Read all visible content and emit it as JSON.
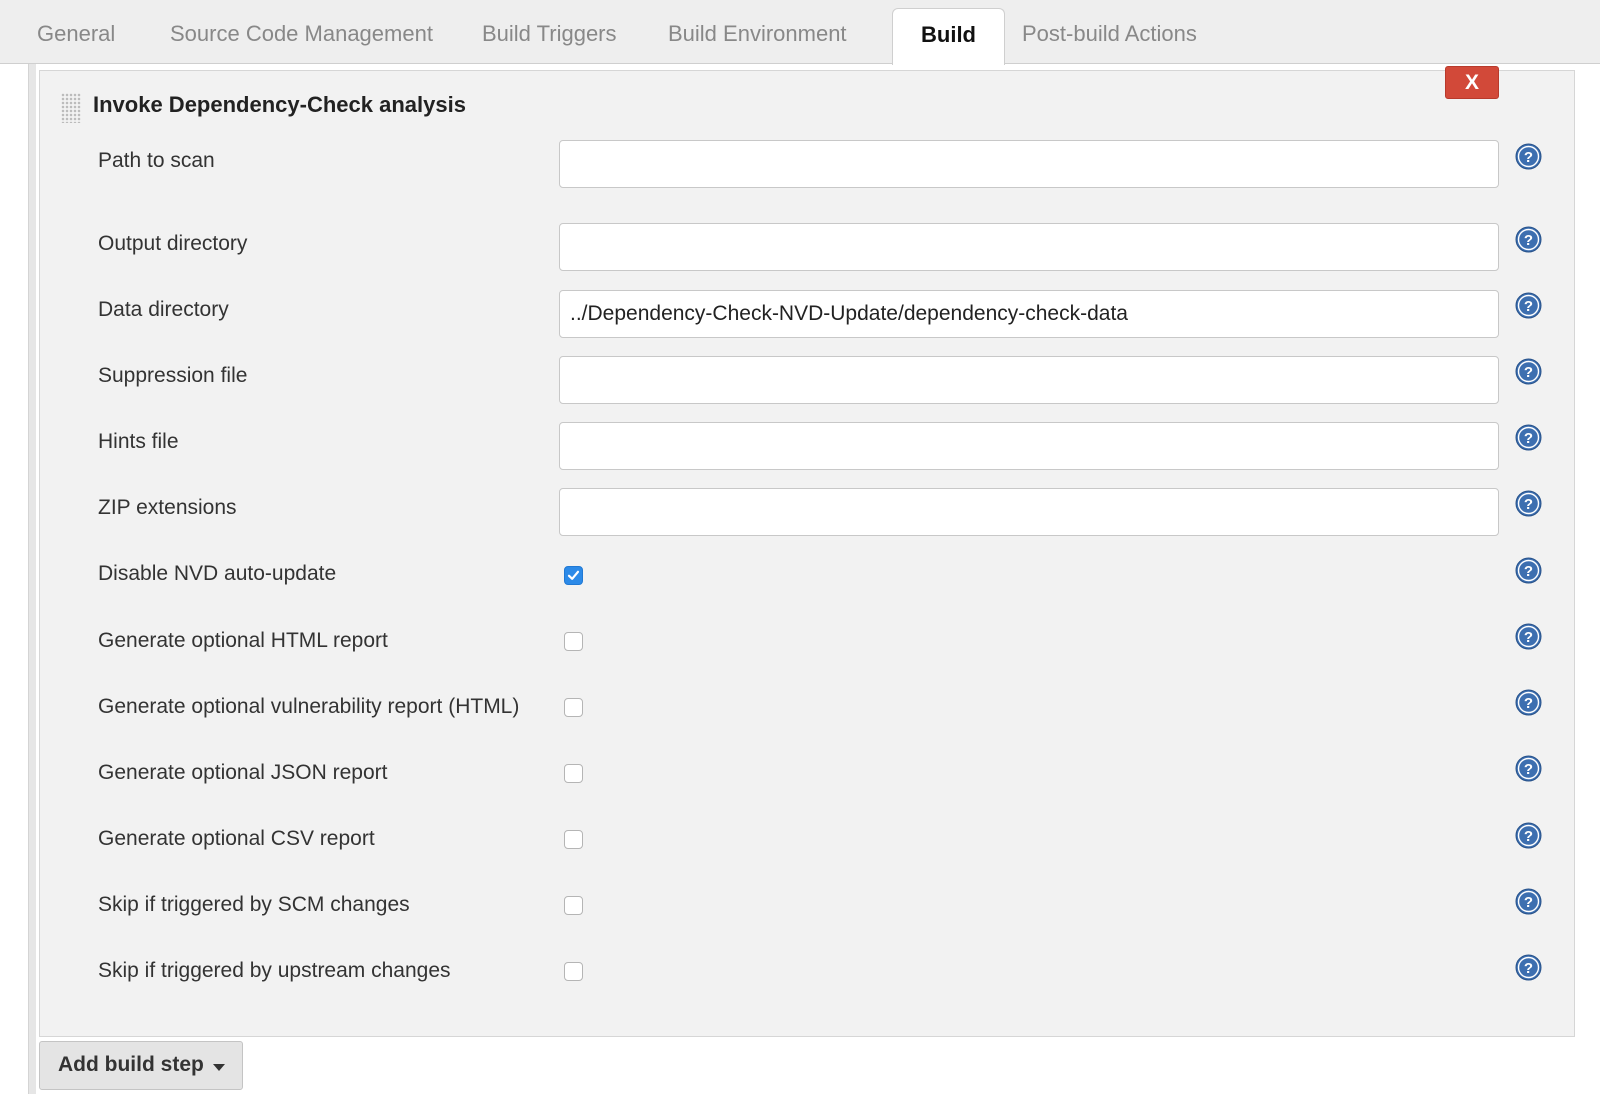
{
  "tabs": [
    {
      "label": "General",
      "active": false
    },
    {
      "label": "Source Code Management",
      "active": false
    },
    {
      "label": "Build Triggers",
      "active": false
    },
    {
      "label": "Build Environment",
      "active": false
    },
    {
      "label": "Build",
      "active": true
    },
    {
      "label": "Post-build Actions",
      "active": false
    }
  ],
  "build_step": {
    "title": "Invoke Dependency-Check analysis",
    "delete_label": "X",
    "text_fields": [
      {
        "label": "Path to scan",
        "value": ""
      },
      {
        "label": "Output directory",
        "value": ""
      },
      {
        "label": "Data directory",
        "value": "../Dependency-Check-NVD-Update/dependency-check-data"
      },
      {
        "label": "Suppression file",
        "value": ""
      },
      {
        "label": "Hints file",
        "value": ""
      },
      {
        "label": "ZIP extensions",
        "value": ""
      }
    ],
    "checkboxes": [
      {
        "label": "Disable NVD auto-update",
        "checked": true
      },
      {
        "label": "Generate optional HTML report",
        "checked": false
      },
      {
        "label": "Generate optional vulnerability report (HTML)",
        "checked": false
      },
      {
        "label": "Generate optional JSON report",
        "checked": false
      },
      {
        "label": "Generate optional CSV report",
        "checked": false
      },
      {
        "label": "Skip if triggered by SCM changes",
        "checked": false
      },
      {
        "label": "Skip if triggered by upstream changes",
        "checked": false
      }
    ]
  },
  "add_build_step_label": "Add build step",
  "icons": {
    "help": "help-icon",
    "drag": "drag-handle-icon",
    "checkmark": "checkmark-icon",
    "dropdown": "caret-down-icon"
  },
  "colors": {
    "delete_button": "#d24939",
    "checkbox_checked": "#2c8ae8",
    "help_icon": "#3d6fb0",
    "panel_background": "#f2f2f2",
    "tabbar_background": "#eeeeee"
  }
}
